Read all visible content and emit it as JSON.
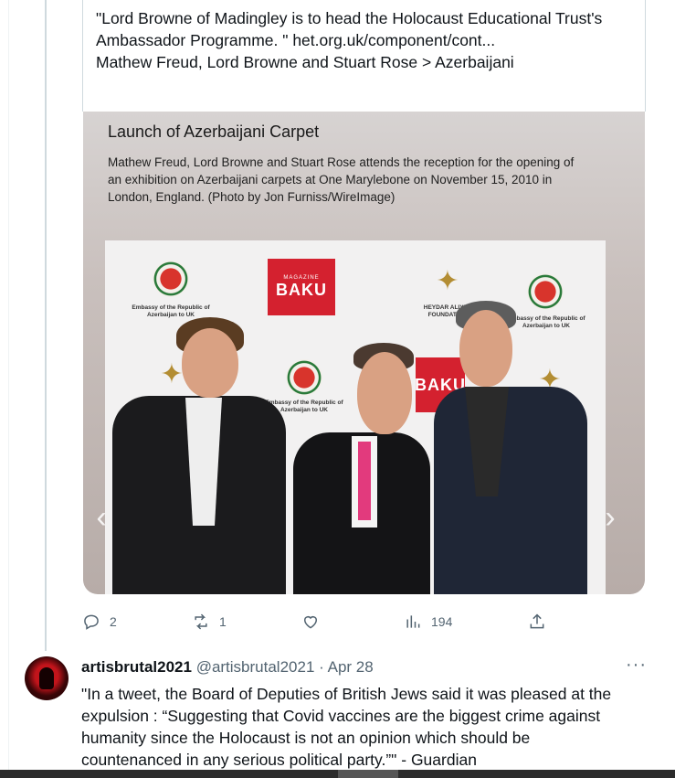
{
  "quoted": {
    "lines": [
      "\"Lord Browne of Madingley is to head the Holocaust Educational Trust's",
      "Ambassador Programme. \" het.org.uk/component/cont...",
      "Mathew Freud, Lord Browne and Stuart Rose > Azerbaijani"
    ]
  },
  "media": {
    "title": "Launch of Azerbaijani Carpet",
    "caption_lines": [
      "Mathew Freud, Lord Browne and Stuart Rose attends the reception for the opening of",
      "an exhibition on Azerbaijani carpets at One Marylebone on November 15, 2010 in",
      "London, England. (Photo by Jon Furniss/WireImage)"
    ],
    "backdrop": {
      "embassy_text": "Embassy of the Republic of Azerbaijan to UK",
      "baku_magazine": "MAGAZINE",
      "baku_word": "BAKU",
      "foundation_text": "HEYDAR ALIYEV FOUNDATION"
    }
  },
  "actions": {
    "replies": "2",
    "retweets": "1",
    "likes": "",
    "views": "194"
  },
  "reply": {
    "name": "artisbrutal2021",
    "handle": "@artisbrutal2021",
    "separator": "·",
    "date": "Apr 28",
    "more": "···",
    "lines": [
      "\"In a tweet, the Board of Deputies of British Jews said it was pleased at the",
      "expulsion : “Suggesting that Covid vaccines are the biggest crime  against",
      "humanity since the Holocaust is not an opinion which should be",
      "countenanced in any serious political party.”\" - Guardian"
    ]
  },
  "colors": {
    "text": "#0f1419",
    "muted": "#536471",
    "border": "#cfd9de",
    "baku_red": "#d4212f"
  }
}
